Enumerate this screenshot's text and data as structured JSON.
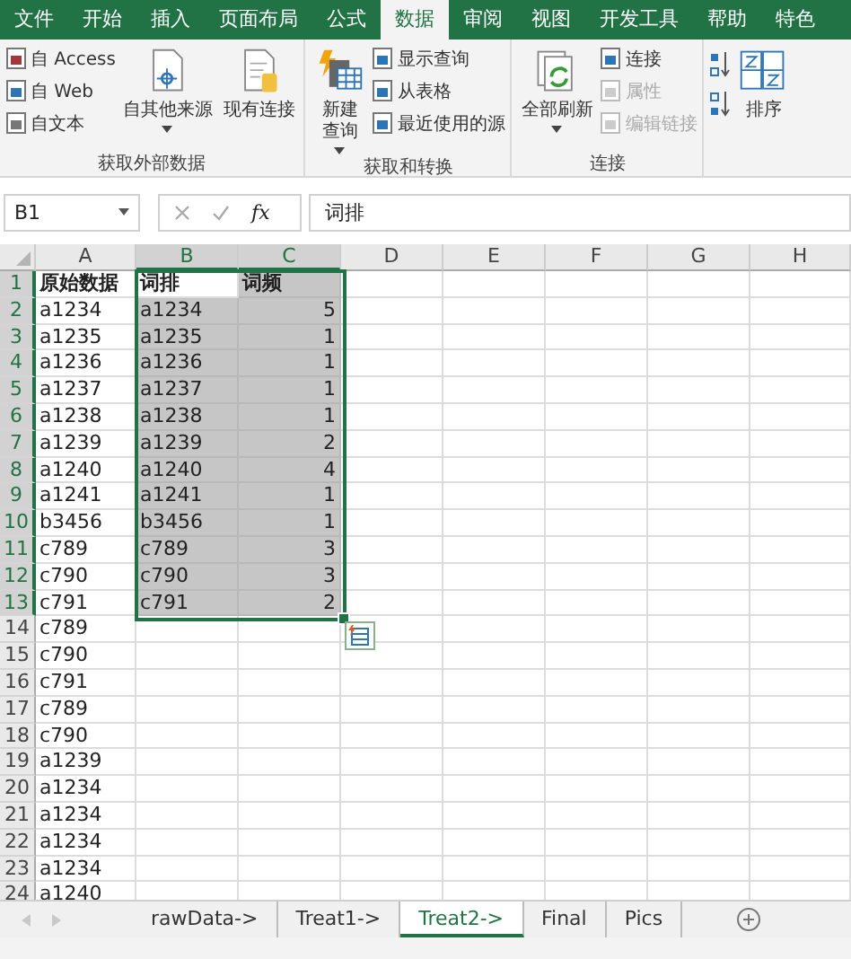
{
  "ribbon_tabs": [
    {
      "label": "文件",
      "selected": false
    },
    {
      "label": "开始",
      "selected": false
    },
    {
      "label": "插入",
      "selected": false
    },
    {
      "label": "页面布局",
      "selected": false
    },
    {
      "label": "公式",
      "selected": false
    },
    {
      "label": "数据",
      "selected": true
    },
    {
      "label": "审阅",
      "selected": false
    },
    {
      "label": "视图",
      "selected": false
    },
    {
      "label": "开发工具",
      "selected": false
    },
    {
      "label": "帮助",
      "selected": false
    },
    {
      "label": "特色",
      "selected": false
    }
  ],
  "ribbon_groups": [
    {
      "label": "获取外部数据",
      "commands": [
        {
          "kind": "small-stack",
          "items": [
            {
              "label": "自 Access",
              "disabled": false
            },
            {
              "label": "自 Web",
              "disabled": false
            },
            {
              "label": "自文本",
              "disabled": false
            }
          ]
        },
        {
          "kind": "large",
          "label": "自其他来源",
          "dropdown": true
        },
        {
          "kind": "large",
          "label": "现有连接",
          "dropdown": false
        }
      ]
    },
    {
      "label": "获取和转换",
      "commands": [
        {
          "kind": "large",
          "label": "新建",
          "label_2": "查询",
          "dropdown": true
        },
        {
          "kind": "small-stack",
          "items": [
            {
              "label": "显示查询",
              "disabled": false
            },
            {
              "label": "从表格",
              "disabled": false
            },
            {
              "label": "最近使用的源",
              "disabled": false
            }
          ]
        }
      ]
    },
    {
      "label": "连接",
      "commands": [
        {
          "kind": "large",
          "label": "全部刷新",
          "dropdown": true
        },
        {
          "kind": "small-stack",
          "items": [
            {
              "label": "连接",
              "disabled": false
            },
            {
              "label": "属性",
              "disabled": true
            },
            {
              "label": "编辑链接",
              "disabled": true
            }
          ]
        }
      ]
    },
    {
      "commands": [
        {
          "kind": "sort-pair"
        },
        {
          "kind": "large",
          "label": "排序",
          "dropdown": false
        }
      ]
    }
  ],
  "formula_bar": {
    "name_box": "B1",
    "function_button": "fx",
    "formula": "词排"
  },
  "columns": [
    {
      "label": "A",
      "selected": false
    },
    {
      "label": "B",
      "selected": true
    },
    {
      "label": "C",
      "selected": true
    },
    {
      "label": "D",
      "selected": false
    },
    {
      "label": "E",
      "selected": false
    },
    {
      "label": "F",
      "selected": false
    },
    {
      "label": "G",
      "selected": false
    },
    {
      "label": "H",
      "selected": false
    }
  ],
  "rows": [
    {
      "number": "1",
      "kind": "header",
      "selected": true,
      "active": true,
      "cells": [
        "原始数据",
        "词排",
        "词频"
      ]
    },
    {
      "number": "2",
      "kind": "data",
      "selected": true,
      "active": false,
      "cells": [
        "a1234",
        "a1234",
        "5"
      ]
    },
    {
      "number": "3",
      "kind": "data",
      "selected": true,
      "active": false,
      "cells": [
        "a1235",
        "a1235",
        "1"
      ]
    },
    {
      "number": "4",
      "kind": "data",
      "selected": true,
      "active": false,
      "cells": [
        "a1236",
        "a1236",
        "1"
      ]
    },
    {
      "number": "5",
      "kind": "data",
      "selected": true,
      "active": false,
      "cells": [
        "a1237",
        "a1237",
        "1"
      ]
    },
    {
      "number": "6",
      "kind": "data",
      "selected": true,
      "active": false,
      "cells": [
        "a1238",
        "a1238",
        "1"
      ]
    },
    {
      "number": "7",
      "kind": "data",
      "selected": true,
      "active": false,
      "cells": [
        "a1239",
        "a1239",
        "2"
      ]
    },
    {
      "number": "8",
      "kind": "data",
      "selected": true,
      "active": false,
      "cells": [
        "a1240",
        "a1240",
        "4"
      ]
    },
    {
      "number": "9",
      "kind": "data",
      "selected": true,
      "active": false,
      "cells": [
        "a1241",
        "a1241",
        "1"
      ]
    },
    {
      "number": "10",
      "kind": "data",
      "selected": true,
      "active": false,
      "cells": [
        "b3456",
        "b3456",
        "1"
      ]
    },
    {
      "number": "11",
      "kind": "data",
      "selected": true,
      "active": false,
      "cells": [
        "c789",
        "c789",
        "3"
      ]
    },
    {
      "number": "12",
      "kind": "data",
      "selected": true,
      "active": false,
      "cells": [
        "c790",
        "c790",
        "3"
      ]
    },
    {
      "number": "13",
      "kind": "data",
      "selected": true,
      "active": false,
      "cells": [
        "c791",
        "c791",
        "2"
      ]
    },
    {
      "number": "14",
      "kind": "data",
      "selected": false,
      "active": false,
      "cells": [
        "c789"
      ]
    },
    {
      "number": "15",
      "kind": "data",
      "selected": false,
      "active": false,
      "cells": [
        "c790"
      ]
    },
    {
      "number": "16",
      "kind": "data",
      "selected": false,
      "active": false,
      "cells": [
        "c791"
      ]
    },
    {
      "number": "17",
      "kind": "data",
      "selected": false,
      "active": false,
      "cells": [
        "c789"
      ]
    },
    {
      "number": "18",
      "kind": "data",
      "selected": false,
      "active": false,
      "cells": [
        "c790"
      ]
    },
    {
      "number": "19",
      "kind": "data",
      "selected": false,
      "active": false,
      "cells": [
        "a1239"
      ]
    },
    {
      "number": "20",
      "kind": "data",
      "selected": false,
      "active": false,
      "cells": [
        "a1234"
      ]
    },
    {
      "number": "21",
      "kind": "data",
      "selected": false,
      "active": false,
      "cells": [
        "a1234"
      ]
    },
    {
      "number": "22",
      "kind": "data",
      "selected": false,
      "active": false,
      "cells": [
        "a1234"
      ]
    },
    {
      "number": "23",
      "kind": "data",
      "selected": false,
      "active": false,
      "cells": [
        "a1234"
      ]
    },
    {
      "number": "24",
      "kind": "data",
      "selected": false,
      "active": false,
      "cells": [
        "a1240"
      ]
    }
  ],
  "sheet_tabs": [
    {
      "label": "rawData->",
      "selected": false
    },
    {
      "label": "Treat1->",
      "selected": false
    },
    {
      "label": "Treat2->",
      "selected": true
    },
    {
      "label": "Final",
      "selected": false
    },
    {
      "label": "Pics",
      "selected": false
    }
  ]
}
